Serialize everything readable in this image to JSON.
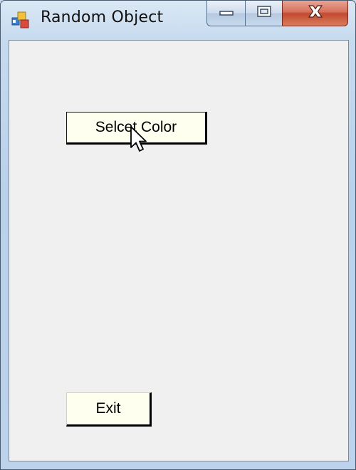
{
  "window": {
    "title": "Random Object",
    "icon": "form-app-icon"
  },
  "caption_buttons": {
    "minimize_icon": "minimize-icon",
    "maximize_icon": "restore-icon",
    "close_icon": "close-icon",
    "close_color": "#c24a2f"
  },
  "form": {
    "select_color_label": "Selcet Color",
    "exit_label": "Exit",
    "button_background": "#fffff0"
  },
  "cursor": {
    "icon": "arrow-cursor-icon"
  }
}
